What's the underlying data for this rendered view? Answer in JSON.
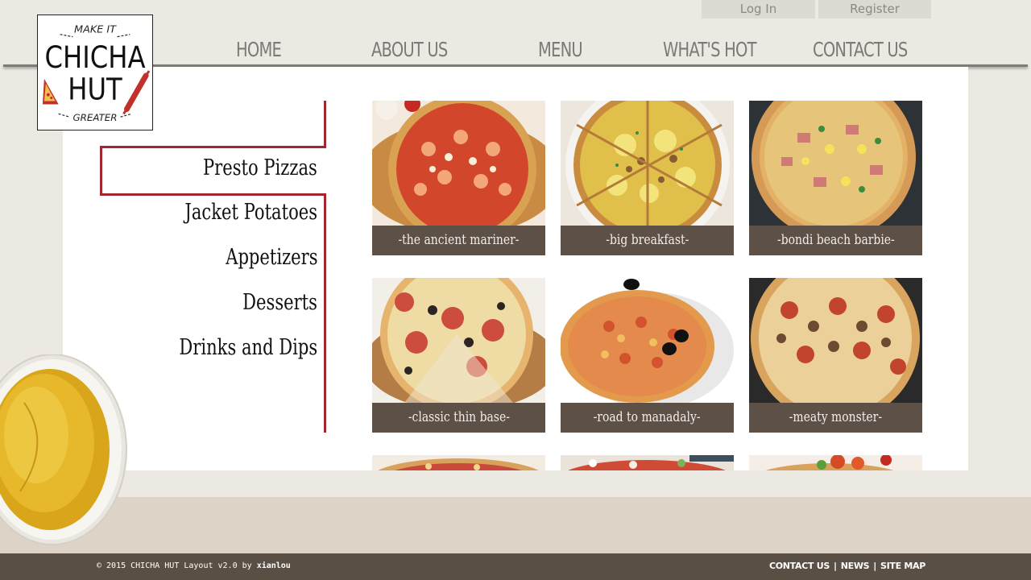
{
  "auth": {
    "login": "Log In",
    "register": "Register"
  },
  "logo": {
    "top": "MAKE IT",
    "line1": "CHICHA",
    "line2": "HUT",
    "bottom": "GREATER"
  },
  "nav": [
    "HOME",
    "ABOUT US",
    "MENU",
    "WHAT'S HOT",
    "CONTACT US"
  ],
  "sidebar": {
    "active": "Presto Pizzas",
    "items": [
      "Presto Pizzas",
      "Jacket Potatoes",
      "Appetizers",
      "Desserts",
      "Drinks and Dips"
    ]
  },
  "pizzas": [
    "-the ancient mariner-",
    "-big breakfast-",
    "-bondi beach barbie-",
    "-classic thin base-",
    "-road to manadaly-",
    "-meaty monster-"
  ],
  "footer": {
    "copyright": "© 2015 CHICHA HUT Layout v2.0 by ",
    "author": "xianlou",
    "links": [
      "CONTACT US",
      "NEWS",
      "SITE MAP"
    ]
  },
  "colors": {
    "accent": "#a2262b",
    "caption_bg": "#5d5047",
    "footer_bg": "#5a4f45",
    "page_bg": "#ece8e2"
  }
}
